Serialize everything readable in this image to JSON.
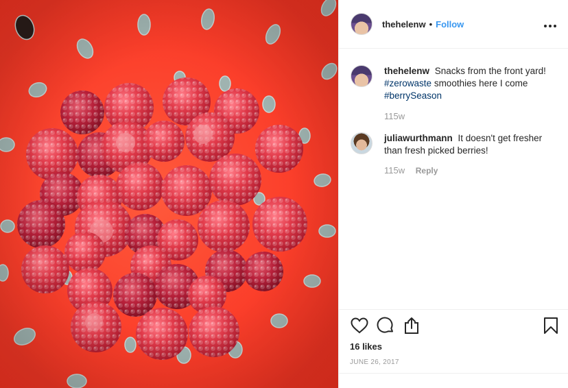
{
  "post": {
    "author": "thehelenw",
    "separator": "•",
    "follow_label": "Follow",
    "more_icon": "more-options-icon"
  },
  "comments": [
    {
      "user": "thehelenw",
      "avatar": "owner",
      "text_before": "Snacks from the front yard!",
      "hashtag1": "#zerowaste",
      "text_middle": "smoothies here I come",
      "hashtag2": "#berrySeason",
      "time": "115w"
    },
    {
      "user": "juliawurthmann",
      "avatar": "julia",
      "text": "It doesn't get fresher than fresh picked berries!",
      "time": "115w",
      "reply_label": "Reply"
    }
  ],
  "actions": {
    "like_icon": "heart-icon",
    "comment_icon": "comment-icon",
    "share_icon": "share-icon",
    "save_icon": "bookmark-icon"
  },
  "likes": "16 likes",
  "date": "June 26, 2017",
  "colors": {
    "follow": "#3897f0",
    "hashtag": "#003569",
    "colander": "#f5391f",
    "raspberry": "#d8283c"
  }
}
